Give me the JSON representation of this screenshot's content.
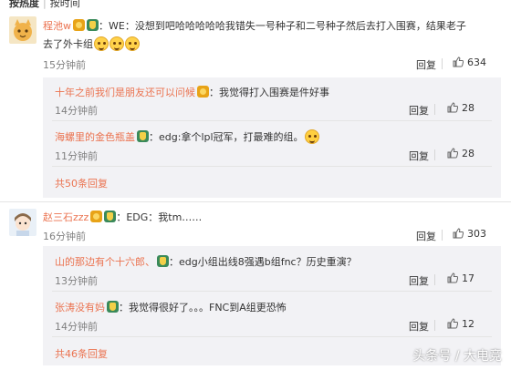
{
  "sort_bar": {
    "hot": "按热度",
    "time": "按时间"
  },
  "comments": [
    {
      "user": "程池w",
      "text": "：没想到吧哈哈哈哈哈我错失一号种子和二号种子然后去打入围赛，结果老子",
      "text_line2": "去了外卡组",
      "time": "15分钟前",
      "reply_label": "回复",
      "likes": "634",
      "avatar_icon": "cat-avatar",
      "badges": [
        "we-fan-icon",
        "lpl-badge-icon",
        "WE"
      ],
      "replies": [
        {
          "user": "十年之前我们是朋友还可以问候",
          "text": "：我觉得打入围赛是件好事",
          "time": "14分钟前",
          "reply_label": "回复",
          "likes": "28"
        },
        {
          "user": "海螺里的金色瓶盖",
          "text": "：edg:拿个lpl冠军，打最难的组。",
          "time": "11分钟前",
          "reply_label": "回复",
          "likes": "28"
        }
      ],
      "more": "共50条回复"
    },
    {
      "user": "赵三石zzz",
      "text": "：EDG：我tm……",
      "time": "16分钟前",
      "reply_label": "回复",
      "likes": "303",
      "avatar_icon": "girl-avatar",
      "replies": [
        {
          "user": "山的那边有个十六郎、",
          "text": "：edg小组出线8强遇b组fnc？历史重演？",
          "time": "13分钟前",
          "reply_label": "回复",
          "likes": "17"
        },
        {
          "user": "张涛没有妈",
          "text": "：我觉得很好了。。。FNC到A组更恐怖",
          "time": "14分钟前",
          "reply_label": "回复",
          "likes": "12"
        }
      ],
      "more": "共46条回复"
    }
  ],
  "watermark": "头条号 / 大电竞",
  "colors": {
    "username": "#eb7350",
    "sub_bg": "#f2f2f5",
    "time": "#808080"
  }
}
